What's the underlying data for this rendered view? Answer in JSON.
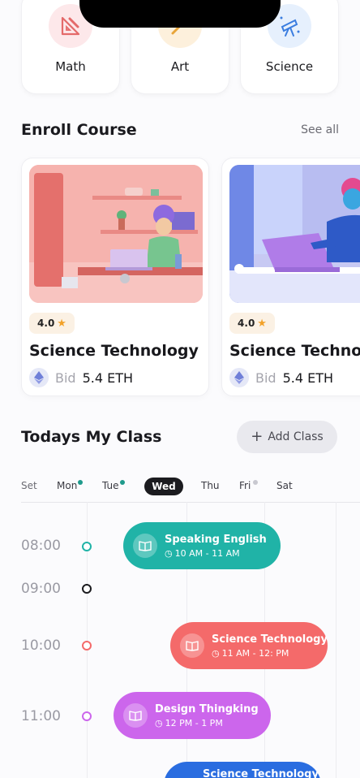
{
  "categories": [
    {
      "label": "Math",
      "icon": "ruler-pencil-icon",
      "bg": "#fde8ea",
      "color": "#e46a6a"
    },
    {
      "label": "Art",
      "icon": "palette-icon",
      "bg": "#fdf0dc",
      "color": "#e8a53a"
    },
    {
      "label": "Science",
      "icon": "telescope-icon",
      "bg": "#e6f0fd",
      "color": "#3a7de0"
    }
  ],
  "enroll": {
    "title": "Enroll Course",
    "see_all": "See all",
    "courses": [
      {
        "rating": "4.0",
        "title": "Science Technology",
        "bid_label": "Bid",
        "bid_value": "5.4 ETH"
      },
      {
        "rating": "4.0",
        "title": "Science Technology",
        "bid_label": "Bid",
        "bid_value": "5.4 ETH"
      }
    ]
  },
  "class": {
    "title": "Todays My Class",
    "add_label": "Add Class",
    "days": [
      "Set",
      "Mon",
      "Tue",
      "Wed",
      "Thu",
      "Fri",
      "Sat"
    ],
    "active_day": "Wed",
    "times": [
      "08:00",
      "09:00",
      "10:00",
      "11:00"
    ],
    "sessions": [
      {
        "title": "Speaking English",
        "time": "10 AM - 11 AM",
        "color": "#20b3a7"
      },
      {
        "title": "Science Technology",
        "time": "11 AM - 12: PM",
        "color": "#f46a6a"
      },
      {
        "title": "Design Thingking",
        "time": "12 PM - 1 PM",
        "color": "#cc66ec"
      },
      {
        "title": "Science Technology",
        "time": "",
        "color": "#2a6de0"
      }
    ]
  },
  "colors": {
    "accent_teal": "#20b3a7",
    "accent_red": "#f46a6a",
    "accent_purple": "#cc66ec",
    "accent_blue": "#2a6de0",
    "star": "#f2a22a"
  }
}
